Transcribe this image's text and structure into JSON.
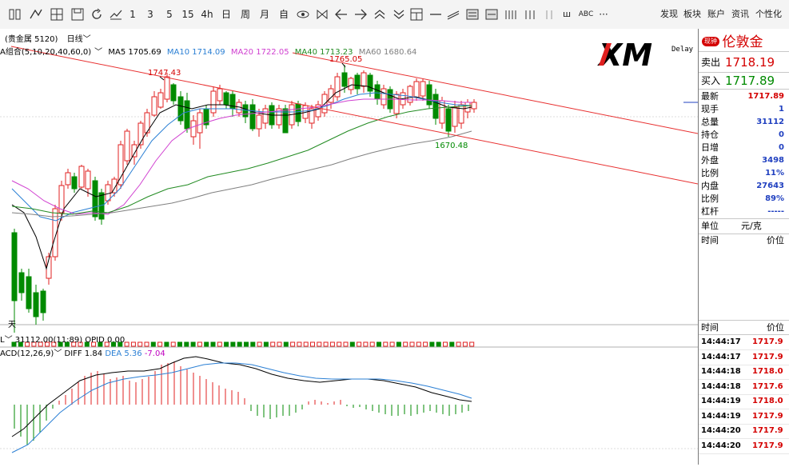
{
  "toolbar": {
    "icons": [
      "split-icon",
      "draw-icon",
      "grid-icon",
      "save-icon",
      "refresh-icon",
      "line-tool-icon"
    ],
    "periods": [
      "1",
      "3",
      "5",
      "15",
      "4h",
      "日",
      "周",
      "月",
      "自"
    ],
    "tools": [
      "eye-icon",
      "zoom-icon",
      "left-arrow-icon",
      "right-arrow-icon",
      "up-chevron-icon",
      "down-chevron-icon",
      "layout-icon",
      "hline-icon",
      "trend-icon",
      "panel1-icon",
      "panel2-icon",
      "bars4-icon",
      "bars3-icon",
      "bars2-icon"
    ],
    "extra1": "ш",
    "extra2": "ABC",
    "more": "···",
    "right_menu": [
      "发现",
      "板块",
      "账户",
      "资讯",
      "个性化"
    ]
  },
  "chart": {
    "instrument": "(贵金属 5120)",
    "period": "日线",
    "indicator_set": "A组合(5,10,20,40,60,0)",
    "ma": [
      {
        "label": "MA5 1705.69",
        "color": "#000000"
      },
      {
        "label": "MA10 1714.09",
        "color": "#2a7fd4"
      },
      {
        "label": "MA20 1722.05",
        "color": "#d040d0"
      },
      {
        "label": "MA40 1713.23",
        "color": "#228b22"
      },
      {
        "label": "MA60 1680.64",
        "color": "#808080"
      }
    ],
    "annotations": {
      "high1": "1747.43",
      "high2": "1765.05",
      "low1": "1670.48"
    },
    "axis_left_label": "天",
    "delay": "Delay",
    "logo_text": "XM",
    "volume_label": "31112.00(11:89)  OPID 0.00",
    "volume_prefix": "L",
    "macd_prefix": "ACD(12,26,9)",
    "macd_diff": "DIFF 1.84",
    "macd_dea": "DEA 5.36",
    "macd_val": "-7.04",
    "colors": {
      "up": "#e02020",
      "down": "#008a00",
      "trend": "#e83030"
    }
  },
  "panel": {
    "badge": "现钟",
    "name": "伦敦金",
    "sell_label": "卖出",
    "sell_value": "1718.19",
    "buy_label": "买入",
    "buy_value": "1717.89",
    "stats": [
      {
        "k": "最新",
        "v": "1717.89",
        "c": "#d40000"
      },
      {
        "k": "现手",
        "v": "1",
        "c": "#2040c0"
      },
      {
        "k": "总量",
        "v": "31112",
        "c": "#2040c0"
      },
      {
        "k": "持仓",
        "v": "0",
        "c": "#2040c0"
      },
      {
        "k": "日增",
        "v": "0",
        "c": "#2040c0"
      },
      {
        "k": "外盘",
        "v": "3498",
        "c": "#2040c0"
      },
      {
        "k": "比例",
        "v": "11%",
        "c": "#2040c0"
      },
      {
        "k": "内盘",
        "v": "27643",
        "c": "#2040c0"
      },
      {
        "k": "比例",
        "v": "89%",
        "c": "#2040c0"
      },
      {
        "k": "杠杆",
        "v": "-----",
        "c": "#2040c0"
      }
    ],
    "unit_label": "单位",
    "unit_value": "元/克",
    "time_header": "时间",
    "price_header": "价位",
    "ticks": [
      {
        "t": "14:44:17",
        "p": "1717.9"
      },
      {
        "t": "14:44:17",
        "p": "1717.9"
      },
      {
        "t": "14:44:18",
        "p": "1718.0"
      },
      {
        "t": "14:44:18",
        "p": "1717.6"
      },
      {
        "t": "14:44:19",
        "p": "1718.0"
      },
      {
        "t": "14:44:19",
        "p": "1717.9"
      },
      {
        "t": "14:44:20",
        "p": "1717.9"
      },
      {
        "t": "14:44:20",
        "p": "1717.9"
      }
    ]
  }
}
